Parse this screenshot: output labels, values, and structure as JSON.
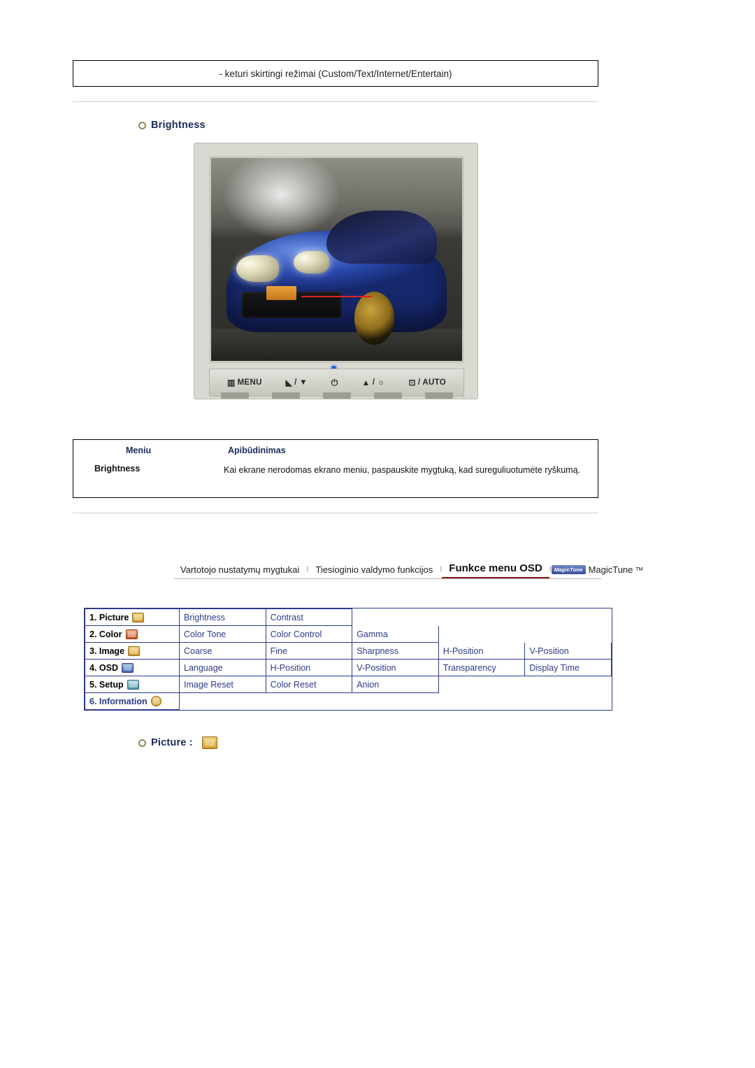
{
  "top_note": "- keturi skirtingi režimai (Custom/Text/Internet/Entertain)",
  "brightness_section": {
    "heading": "Brightness"
  },
  "monitor": {
    "buttons": [
      {
        "name": "menu-button",
        "glyph": "▥",
        "label": "MENU"
      },
      {
        "name": "source-down-button",
        "glyph": "◣",
        "label": "/ ▼"
      },
      {
        "name": "power-button",
        "glyph": "⏻",
        "label": ""
      },
      {
        "name": "up-brightness-button",
        "glyph": "▲",
        "label": "/ ☼"
      },
      {
        "name": "enter-auto-button",
        "glyph": "⊡",
        "label": "/ AUTO"
      }
    ]
  },
  "desc_table": {
    "headers": {
      "menu": "Meniu",
      "description": "Apibūdinimas"
    },
    "row": {
      "menu": "Brightness",
      "description": "Kai ekrane nerodomas ekrano meniu, paspauskite mygtuką, kad sureguliuotumėte ryškumą."
    }
  },
  "tabstrip": {
    "items": [
      {
        "label": "Vartotojo nustatymų mygtukai",
        "active": false
      },
      {
        "label": "Tiesioginio valdymo funkcijos",
        "active": false
      },
      {
        "label": "Funkce menu OSD",
        "active": true
      }
    ],
    "separator": "I",
    "logo": {
      "chip": "MagicTune",
      "text": "MagicTune",
      "tm": "TM"
    }
  },
  "menu_map": {
    "rows": [
      {
        "lead": "1. Picture",
        "icon": "picture-icon",
        "icon_class": "",
        "cells": [
          "Brightness",
          "Contrast"
        ],
        "span_rest": true
      },
      {
        "lead": "2. Color",
        "icon": "color-icon",
        "icon_class": "red",
        "cells": [
          "Color Tone",
          "Color Control",
          "Gamma"
        ],
        "span_rest": true
      },
      {
        "lead": "3. Image",
        "icon": "image-icon",
        "icon_class": "",
        "cells": [
          "Coarse",
          "Fine",
          "Sharpness",
          "H-Position",
          "V-Position"
        ],
        "span_rest": false
      },
      {
        "lead": "4. OSD",
        "icon": "osd-icon",
        "icon_class": "blue",
        "cells": [
          "Language",
          "H-Position",
          "V-Position",
          "Transparency",
          "Display Time"
        ],
        "span_rest": false
      },
      {
        "lead": "5. Setup",
        "icon": "setup-icon",
        "icon_class": "teal",
        "cells": [
          "Image Reset",
          "Color Reset",
          "Anion"
        ],
        "span_rest": true
      },
      {
        "lead": "6. Information",
        "icon": "information-icon",
        "icon_class": "info",
        "cells": [],
        "span_rest": true
      }
    ]
  },
  "picture_section": {
    "heading": "Picture :"
  }
}
